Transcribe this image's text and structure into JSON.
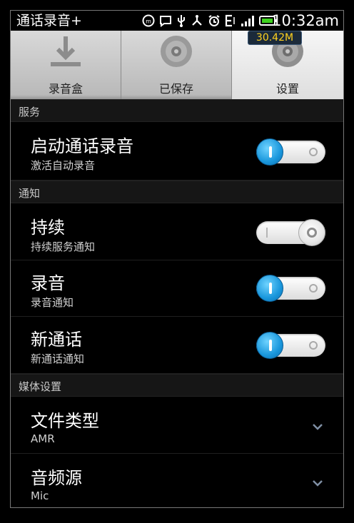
{
  "status_bar": {
    "app_title": "通话录音+",
    "time": "10:32am",
    "icons": [
      "m-badge-icon",
      "message-icon",
      "usb-icon",
      "usb-connect-icon",
      "alarm-icon",
      "data-e-icon",
      "signal-icon",
      "battery-icon"
    ]
  },
  "tabs": [
    {
      "label": "录音盒",
      "icon": "download-icon"
    },
    {
      "label": "已保存",
      "icon": "disc-icon"
    },
    {
      "label": "设置",
      "icon": "disc-icon",
      "active": true
    }
  ],
  "memory_badge": "30.42M",
  "sections": {
    "service": {
      "header": "服务",
      "items": [
        {
          "title": "启动通话录音",
          "subtitle": "激活自动录音",
          "toggle": true
        }
      ]
    },
    "notify": {
      "header": "通知",
      "items": [
        {
          "title": "持续",
          "subtitle": "持续服务通知",
          "toggle": false
        },
        {
          "title": "录音",
          "subtitle": "录音通知",
          "toggle": true
        },
        {
          "title": "新通话",
          "subtitle": "新通话通知",
          "toggle": true
        }
      ]
    },
    "media": {
      "header": "媒体设置",
      "items": [
        {
          "title": "文件类型",
          "value": "AMR"
        },
        {
          "title": "音频源",
          "value": "Mic"
        }
      ]
    }
  },
  "colors": {
    "toggle_on": "#1a97dc",
    "header_bg": "#161616",
    "badge_text": "#ffd21e"
  }
}
